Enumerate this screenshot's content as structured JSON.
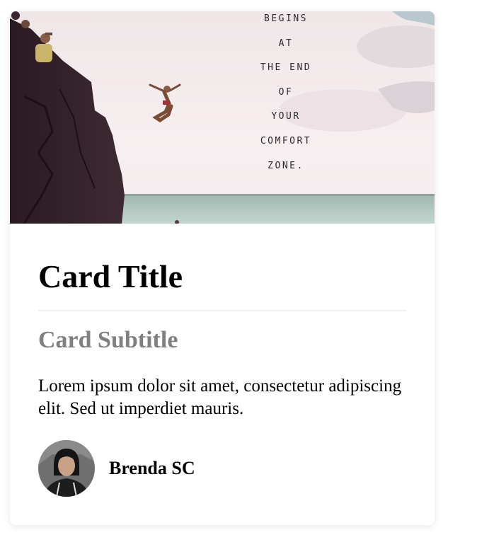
{
  "card": {
    "image": {
      "alt_icon": "cliff-jump-photo",
      "quote_lines": [
        "BEGINS",
        "AT",
        "THE END",
        "OF",
        "YOUR",
        "COMFORT",
        "ZONE."
      ]
    },
    "title": "Card Title",
    "subtitle": "Card Subtitle",
    "text": "Lorem ipsum dolor sit amet, consectetur adipiscing elit. Sed ut imperdiet mauris.",
    "author": {
      "name": "Brenda SC",
      "avatar_icon": "person-avatar"
    }
  },
  "colors": {
    "card_background": "#ffffff",
    "title": "#000000",
    "subtitle": "#808080",
    "divider": "#eeeeee"
  }
}
